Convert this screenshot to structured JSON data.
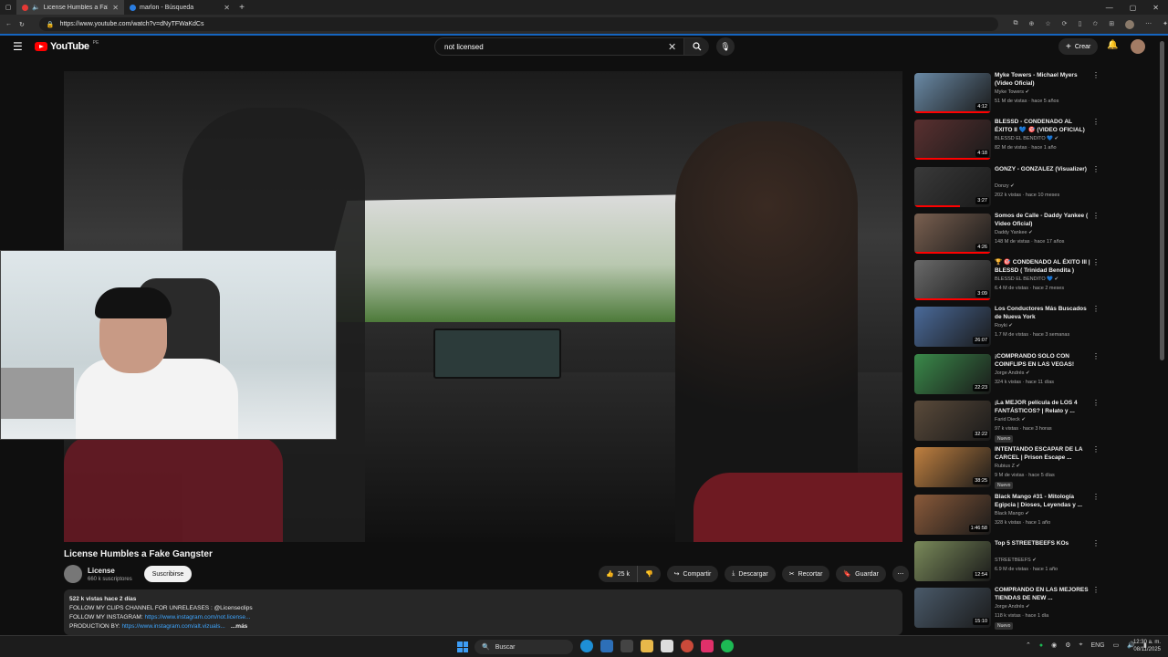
{
  "browser": {
    "tabs": [
      {
        "title": "License Humbles a Fake Gangster",
        "active": true
      },
      {
        "title": "marlon - Búsqueda",
        "active": false
      }
    ],
    "url": "https://www.youtube.com/watch?v=dNyTFWaKdCs"
  },
  "header": {
    "logo_text": "YouTube",
    "logo_sup": "PE",
    "search_value": "not licensed",
    "create_label": "Crear"
  },
  "video": {
    "title": "License Humbles a Fake Gangster",
    "channel": "License",
    "subscribers": "660 k suscriptores",
    "subscribe_label": "Suscribirse",
    "likes": "25 k",
    "share_label": "Compartir",
    "download_label": "Descargar",
    "clip_label": "Recortar",
    "save_label": "Guardar",
    "desc_meta": "522 k vistas  hace 2 días",
    "desc_line1": "FOLLOW MY CLIPS CHANNEL FOR UNRELEASES :  @Licenseclips",
    "desc_line2_label": "FOLLOW MY INSTAGRAM: ",
    "desc_line2_link": "https://www.instagram.com/not.license...",
    "desc_line3_label": "PRODUCTION BY: ",
    "desc_line3_link": "https://www.instagram.com/alt.vizuals...",
    "desc_more": "...más"
  },
  "recommendations": [
    {
      "title": "Myke Towers - Michael Myers (Video Oficial)",
      "channel": "Myke Towers",
      "meta": "51 M de vistas · hace 5 años",
      "duration": "4:12",
      "color": "#6a8aa6",
      "progress": 1.0,
      "new": false
    },
    {
      "title": "BLESSD - CONDENADO AL ÉXITO II 💙 🎯 (VIDEO OFICIAL)",
      "channel": "BLESSD EL BENDITO 💙",
      "meta": "82 M de vistas · hace 1 año",
      "duration": "4:18",
      "color": "#5a3030",
      "progress": 1.0,
      "new": false
    },
    {
      "title": "GONZY - GONZALEZ (Visualizer)",
      "channel": "Donzy",
      "meta": "202 k vistas · hace 10 meses",
      "duration": "3:27",
      "color": "#3a3a3a",
      "progress": 0.6,
      "new": false
    },
    {
      "title": "Somos de Calle - Daddy Yankee ( Video Oficial)",
      "channel": "Daddy Yankee",
      "meta": "148 M de vistas · hace 17 años",
      "duration": "4:26",
      "color": "#7a6050",
      "progress": 1.0,
      "new": false
    },
    {
      "title": "🏆 🎯 CONDENADO AL ÉXITO III | BLESSD ( Trinidad Bendita )",
      "channel": "BLESSD EL BENDITO 💙",
      "meta": "6.4 M de vistas · hace 2 meses",
      "duration": "3:09",
      "color": "#6a6a6a",
      "progress": 1.0,
      "new": false
    },
    {
      "title": "Los Conductores Más Buscados de Nueva York",
      "channel": "Royki",
      "meta": "1.7 M de vistas · hace 3 semanas",
      "duration": "26:07",
      "color": "#4a6a9a",
      "progress": 0.0,
      "new": false
    },
    {
      "title": "¡COMPRANDO SOLO CON COINFLIPS EN LAS VEGAS!",
      "channel": "Jorge Andrés",
      "meta": "324 k vistas · hace 11 días",
      "duration": "22:23",
      "color": "#3a8a4a",
      "progress": 0.0,
      "new": false
    },
    {
      "title": "¡La MEJOR película de LOS 4 FANTÁSTICOS? | Relato y ...",
      "channel": "Farid Dieck",
      "meta": "97 k vistas · hace 3 horas",
      "duration": "32:22",
      "color": "#5a4a3a",
      "progress": 0.0,
      "new": true
    },
    {
      "title": "INTENTANDO ESCAPAR DE LA CARCEL | Prison Escape ...",
      "channel": "Rubius Z",
      "meta": "9 M de vistas · hace 5 días",
      "duration": "38:25",
      "color": "#c08040",
      "progress": 0.0,
      "new": true
    },
    {
      "title": "Black Mango #31 - Mitología Egipcia | Dioses, Leyendas y ...",
      "channel": "Black Mango",
      "meta": "328 k vistas · hace 1 año",
      "duration": "1:46:58",
      "color": "#8a5a3a",
      "progress": 0.0,
      "new": false
    },
    {
      "title": "Top 5 STREETBEEFS KOs",
      "channel": "STREETBEEFS",
      "meta": "6.9 M de vistas · hace 1 año",
      "duration": "12:54",
      "color": "#7a8a5a",
      "progress": 0.0,
      "new": false
    },
    {
      "title": "COMPRANDO EN LAS MEJORES TIENDAS DE NEW ...",
      "channel": "Jorge Andrés",
      "meta": "118 k vistas · hace 1 día",
      "duration": "15:10",
      "color": "#4a5a6a",
      "progress": 0.0,
      "new": true
    }
  ],
  "new_badge": "Nuevo",
  "taskbar": {
    "search_label": "Buscar",
    "lang": "ENG",
    "time": "12:30 a. m.",
    "date": "08/11/2025"
  }
}
